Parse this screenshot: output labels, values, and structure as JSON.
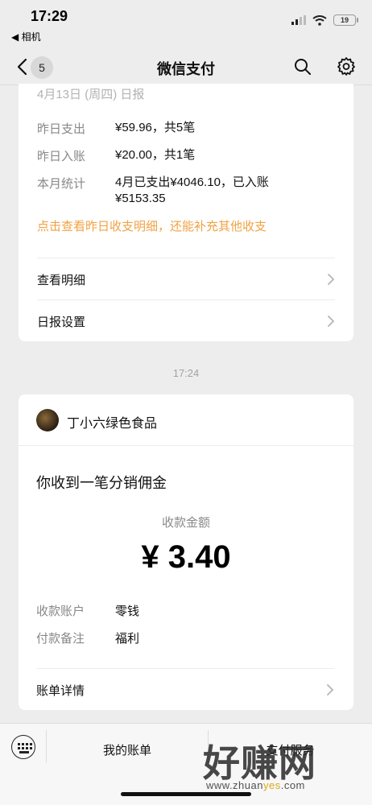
{
  "status_bar": {
    "time": "17:29",
    "back_app": "◀ 相机",
    "battery": "19"
  },
  "nav": {
    "badge": "5",
    "title": "微信支付"
  },
  "daily_report": {
    "title": "4月13日 (周四) 日报",
    "rows": [
      {
        "label": "昨日支出",
        "value": "¥59.96，共5笔"
      },
      {
        "label": "昨日入账",
        "value": "¥20.00，共1笔"
      },
      {
        "label": "本月统计",
        "value": "4月已支出¥4046.10，已入账¥5153.35"
      }
    ],
    "link": "点击查看昨日收支明细，还能补充其他收支",
    "menu": [
      {
        "label": "查看明细"
      },
      {
        "label": "日报设置"
      }
    ]
  },
  "timestamp": "17:24",
  "payment_notice": {
    "merchant": "丁小六绿色食品",
    "title": "你收到一笔分销佣金",
    "amount_label": "收款金额",
    "amount": "¥ 3.40",
    "details": [
      {
        "label": "收款账户",
        "value": "零钱"
      },
      {
        "label": "付款备注",
        "value": "福利"
      }
    ],
    "menu_label": "账单详情"
  },
  "bottom_bar": {
    "tab1": "我的账单",
    "tab2": "支付服务"
  },
  "watermark": {
    "text": "好赚网",
    "url_a": "www.zhuan",
    "url_b": "yes",
    "url_c": ".com"
  },
  "colors": {
    "accent_orange": "#f0a243",
    "background": "#ededed"
  }
}
